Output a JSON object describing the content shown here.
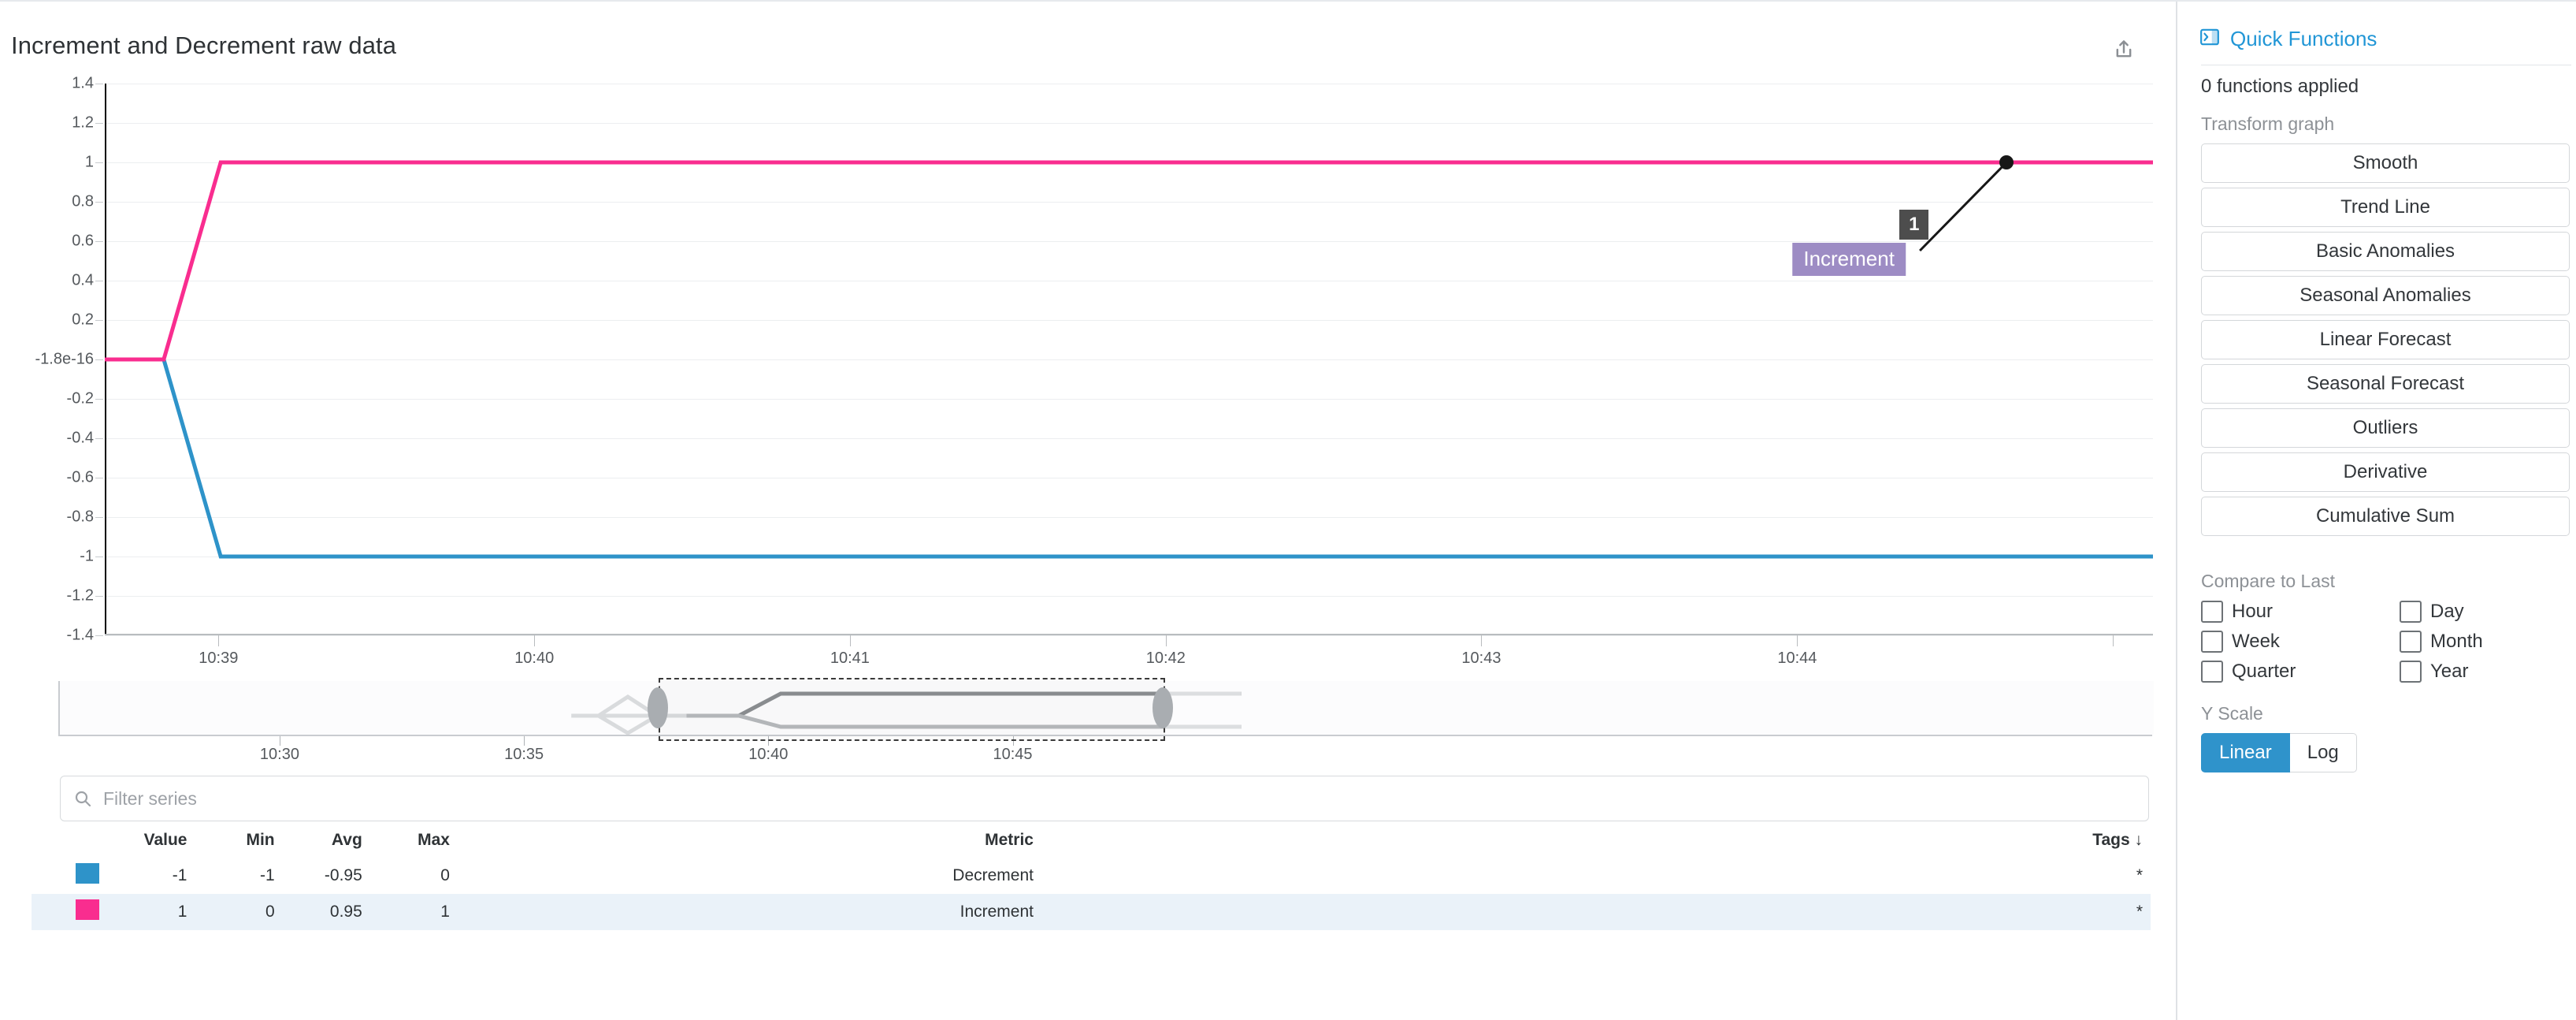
{
  "panel": {
    "title": "Increment and Decrement raw data",
    "share_icon": "share-icon"
  },
  "chart_data": {
    "type": "line",
    "title": "Increment and Decrement raw data",
    "xlabel": "",
    "ylabel": "",
    "grid": true,
    "legend_position": "below-as-table",
    "ylim": [
      -1.4,
      1.4
    ],
    "yticks": [
      "1.4",
      "1.2",
      "1",
      "0.8",
      "0.6",
      "0.4",
      "0.2",
      "-1.8e-16",
      "-0.2",
      "-0.4",
      "-0.6",
      "-0.8",
      "-1",
      "-1.2",
      "-1.4"
    ],
    "ytick_values": [
      1.4,
      1.2,
      1,
      0.8,
      0.6,
      0.4,
      0.2,
      0,
      -0.2,
      -0.4,
      -0.6,
      -0.8,
      -1,
      -1.2,
      -1.4
    ],
    "xticks": [
      "10:39",
      "10:40",
      "10:41",
      "10:42",
      "10:43",
      "10:44"
    ],
    "xtick_positions": [
      0.0555,
      0.2097,
      0.3638,
      0.518,
      0.6721,
      0.8263
    ],
    "series": [
      {
        "name": "Decrement",
        "color": "#2e93c9",
        "points": [
          {
            "x": 0.0,
            "y": 0
          },
          {
            "x": 0.0288,
            "y": 0
          },
          {
            "x": 0.0566,
            "y": -1
          },
          {
            "x": 1.0,
            "y": -1
          }
        ]
      },
      {
        "name": "Increment",
        "color": "#f92d8f",
        "points": [
          {
            "x": 0.0,
            "y": 0
          },
          {
            "x": 0.0288,
            "y": 0
          },
          {
            "x": 0.0566,
            "y": 1
          },
          {
            "x": 1.0,
            "y": 1
          }
        ]
      }
    ],
    "annotation": {
      "series": "Increment",
      "value": "1",
      "label": "Increment",
      "point_x": 0.9285,
      "point_y": 1
    }
  },
  "brush": {
    "xticks": [
      "10:30",
      "10:35",
      "10:40",
      "10:45"
    ],
    "xtick_positions": [
      0.1057,
      0.2224,
      0.3391,
      0.4558
    ],
    "selection_start_label": "10:38.6",
    "selection_end_label": "10:44.9"
  },
  "filter": {
    "placeholder": "Filter series",
    "value": "",
    "icon": "search-icon"
  },
  "legend": {
    "columns": [
      "Value",
      "Min",
      "Avg",
      "Max",
      "Metric",
      "Tags"
    ],
    "sorted_column": "Tags",
    "sort_arrow": "↓",
    "rows": [
      {
        "color": "#2e93c9",
        "value": "-1",
        "min": "-1",
        "avg": "-0.95",
        "max": "0",
        "metric": "Decrement",
        "tags": "*"
      },
      {
        "color": "#f92d8f",
        "value": "1",
        "min": "0",
        "avg": "0.95",
        "max": "1",
        "metric": "Increment",
        "tags": "*"
      }
    ]
  },
  "sidebar": {
    "header": "Quick Functions",
    "header_icon": "expand-panel-icon",
    "applied": "0 functions applied",
    "transform_label": "Transform graph",
    "transform_buttons": [
      "Smooth",
      "Trend Line",
      "Basic Anomalies",
      "Seasonal Anomalies",
      "Linear Forecast",
      "Seasonal Forecast",
      "Outliers",
      "Derivative",
      "Cumulative Sum"
    ],
    "compare_label": "Compare to Last",
    "compare_options": [
      "Hour",
      "Day",
      "Week",
      "Month",
      "Quarter",
      "Year"
    ],
    "compare_checked": [
      false,
      false,
      false,
      false,
      false,
      false
    ],
    "yscale_label": "Y Scale",
    "yscale_options": [
      "Linear",
      "Log"
    ],
    "yscale_selected": "Linear"
  },
  "colors": {
    "accent": "#2196d6",
    "active": "#2f93cb",
    "series_blue": "#2e93c9",
    "series_pink": "#f92d8f",
    "annotation_value_bg": "#4d4d4d",
    "annotation_label_bg": "#9d8cc4"
  }
}
